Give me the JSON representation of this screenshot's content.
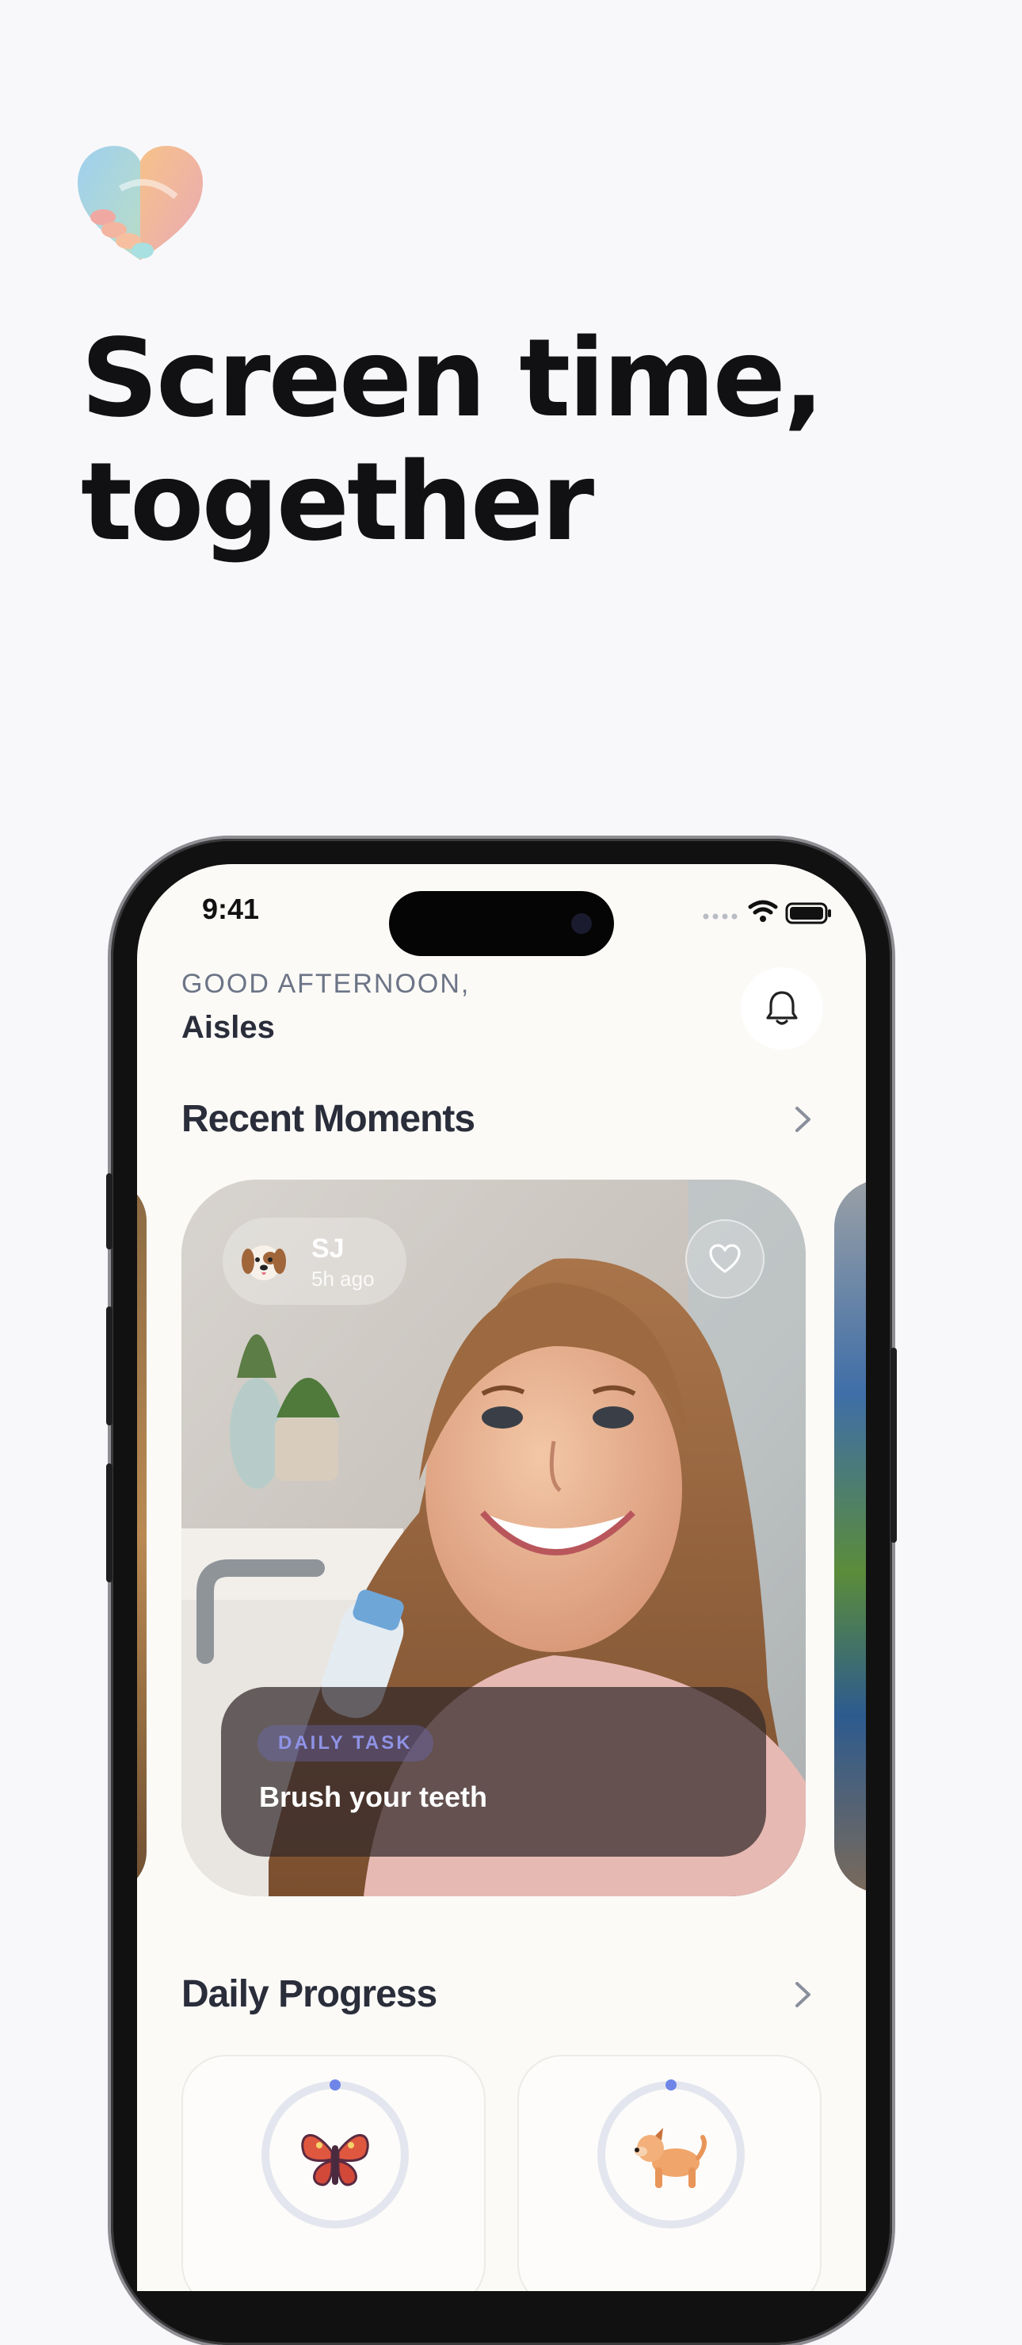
{
  "hero": {
    "headline_line1": "Screen time,",
    "headline_line2": "together",
    "logo_icon": "handshake-heart-icon"
  },
  "status_bar": {
    "time": "9:41"
  },
  "greeting": {
    "salutation": "GOOD AFTERNOON,",
    "name": "Aisles"
  },
  "recent_moments": {
    "title": "Recent Moments",
    "card": {
      "author_initials": "SJ",
      "author_avatar": "puppy-emoji",
      "time_ago": "5h ago",
      "badge": "DAILY TASK",
      "task": "Brush your teeth"
    }
  },
  "daily_progress": {
    "title": "Daily Progress",
    "items": [
      {
        "icon": "butterfly-icon",
        "progress": 0.0
      },
      {
        "icon": "dog-icon",
        "progress": 0.0
      }
    ]
  },
  "colors": {
    "accent": "#6f86e8",
    "headline": "#111114",
    "ring_track": "#e3e6ee",
    "badge_text": "#8f93e6"
  }
}
